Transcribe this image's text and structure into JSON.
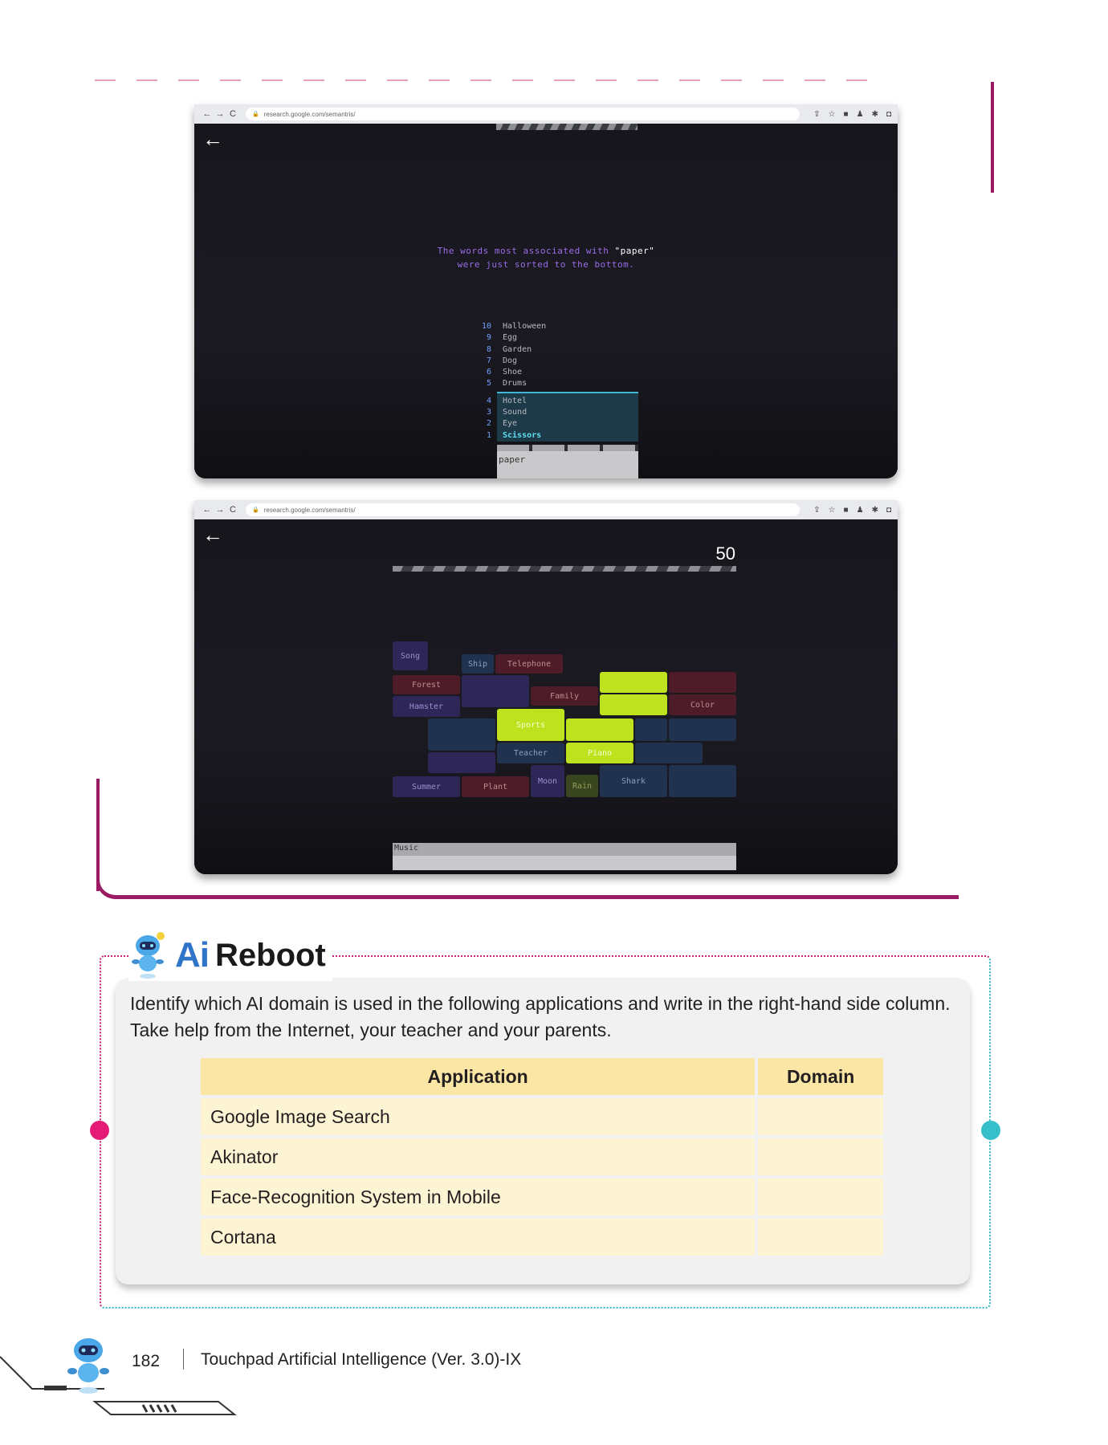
{
  "browser": {
    "url": "research.google.com/semantris/"
  },
  "screenshot1": {
    "message_line1_pre": "The words most associated with ",
    "message_word": "\"paper\"",
    "message_line2": "were just sorted to the bottom.",
    "upper_ranks": [
      {
        "num": "10",
        "word": "Halloween"
      },
      {
        "num": "9",
        "word": "Egg"
      },
      {
        "num": "8",
        "word": "Garden"
      },
      {
        "num": "7",
        "word": "Dog"
      },
      {
        "num": "6",
        "word": "Shoe"
      },
      {
        "num": "5",
        "word": "Drums"
      }
    ],
    "lower_ranks": [
      {
        "num": "4",
        "word": "Hotel"
      },
      {
        "num": "3",
        "word": "Sound"
      },
      {
        "num": "2",
        "word": "Eye"
      },
      {
        "num": "1",
        "word": "Scissors"
      }
    ],
    "input_value": "paper"
  },
  "screenshot2": {
    "score": "50",
    "blocks": {
      "song": "Song",
      "ship": "Ship",
      "telephone": "Telephone",
      "forest": "Forest",
      "family": "Family",
      "hamster": "Hamster",
      "color": "Color",
      "sports": "Sports",
      "teacher": "Teacher",
      "piano": "Piano",
      "summer": "Summer",
      "plant": "Plant",
      "moon": "Moon",
      "rain": "Rain",
      "shark": "Shark"
    },
    "input_value": "Music"
  },
  "ai_reboot": {
    "heading_ai": "Ai",
    "heading_rest": "Reboot",
    "instructions": "Identify which AI domain is used in the following applications and write in the right-hand side column. Take help from the Internet, your teacher and your parents.",
    "columns": [
      "Application",
      "Domain"
    ],
    "rows": [
      {
        "application": "Google Image Search",
        "domain": ""
      },
      {
        "application": "Akinator",
        "domain": ""
      },
      {
        "application": "Face-Recognition System in Mobile",
        "domain": ""
      },
      {
        "application": "Cortana",
        "domain": ""
      }
    ]
  },
  "footer": {
    "page_number": "182",
    "book_title": "Touchpad Artificial Intelligence (Ver. 3.0)-IX"
  },
  "colors": {
    "accent_magenta": "#9a1b63",
    "dot_pink": "#e41b77",
    "dot_teal": "#37c0cc",
    "table_header": "#fbe6a6",
    "table_cell": "#fdf4d4",
    "heading_blue": "#2f74c9"
  }
}
